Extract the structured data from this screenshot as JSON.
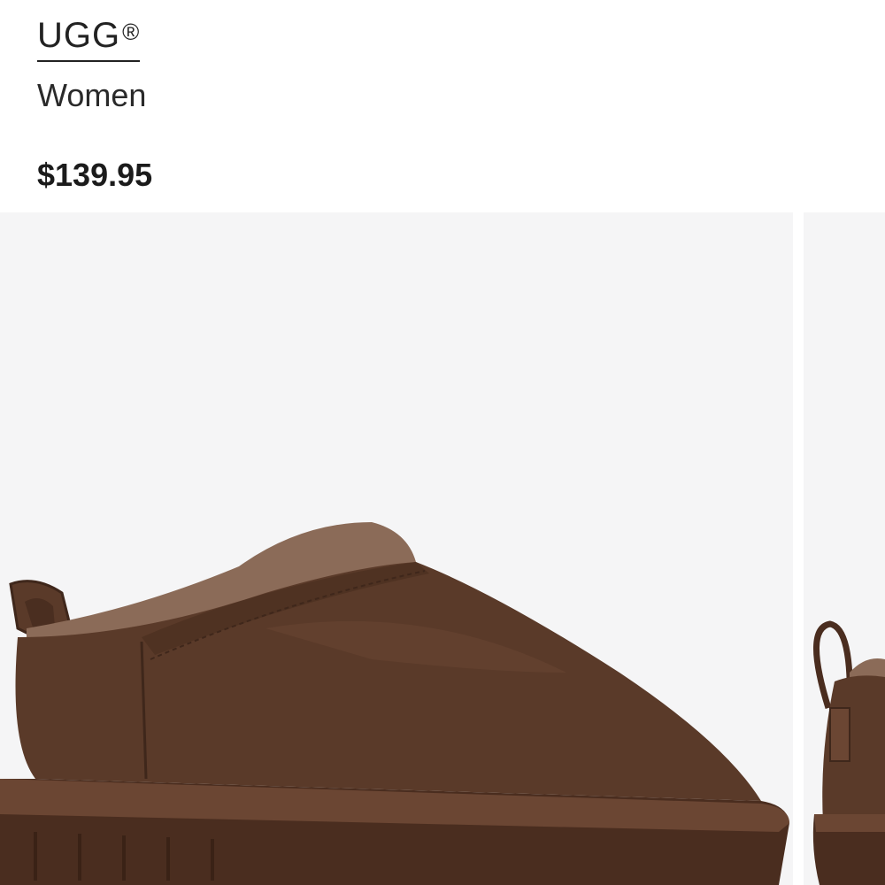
{
  "product": {
    "brand": "UGG",
    "brand_mark": "®",
    "category": "Women",
    "price": "$139.95"
  },
  "gallery": {
    "images": [
      {
        "name": "product-image-1",
        "subject": "brown suede slip-on clog with shearling lining"
      },
      {
        "name": "product-image-2",
        "subject": "rear view of brown suede slipper with pull loop"
      }
    ],
    "colors": {
      "background": "#f5f5f6",
      "suede": "#5a3a29",
      "shearling": "#8b6b58",
      "sole": "#4a2d1f"
    }
  }
}
